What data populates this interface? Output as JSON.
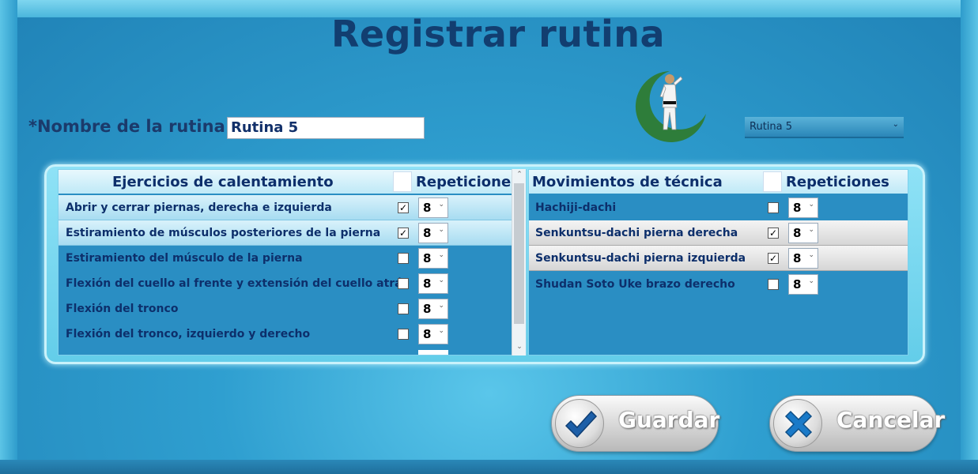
{
  "window": {
    "title": "Registrar rutina"
  },
  "form": {
    "name_label": "*Nombre de la rutina:",
    "name_value": "Rutina 5"
  },
  "routine_select": {
    "value": "Rutina 5"
  },
  "warmup": {
    "header_name": "Ejercicios de calentamiento",
    "header_reps": "Repeticiones",
    "rows": [
      {
        "label": "Abrir y cerrar piernas, derecha e izquierda",
        "checked": "✓",
        "reps": "8"
      },
      {
        "label": "Estiramiento de músculos posteriores de la pierna",
        "checked": "✓",
        "reps": "8"
      },
      {
        "label": "Estiramiento del músculo de la pierna",
        "checked": "",
        "reps": "8"
      },
      {
        "label": "Flexión del cuello al frente y extensión del cuello atrás",
        "checked": "",
        "reps": "8"
      },
      {
        "label": "Flexión del tronco",
        "checked": "",
        "reps": "8"
      },
      {
        "label": "Flexión del tronco, izquierdo y derecho",
        "checked": "",
        "reps": "8"
      }
    ]
  },
  "technique": {
    "header_name": "Movimientos de técnica",
    "header_reps": "Repeticiones",
    "rows": [
      {
        "label": "Hachiji-dachi",
        "checked": "",
        "reps": "8"
      },
      {
        "label": "Senkuntsu-dachi pierna derecha",
        "checked": "✓",
        "reps": "8"
      },
      {
        "label": "Senkuntsu-dachi pierna izquierda",
        "checked": "✓",
        "reps": "8"
      },
      {
        "label": "Shudan Soto Uke brazo derecho",
        "checked": "",
        "reps": "8"
      }
    ]
  },
  "buttons": {
    "save": "Guardar",
    "cancel": "Cancelar"
  },
  "icons": {
    "save": "checkmark-icon",
    "cancel": "x-icon",
    "select_chevron": "chevron-down-icon",
    "scroll_up": "chevron-up-icon",
    "scroll_down": "chevron-down-icon"
  },
  "colors": {
    "title": "#123e70",
    "accent": "#2a8ec3",
    "save_icon": "#1d5fa8",
    "cancel_icon": "#1a7ac8",
    "logo_green": "#2e7d3a"
  }
}
